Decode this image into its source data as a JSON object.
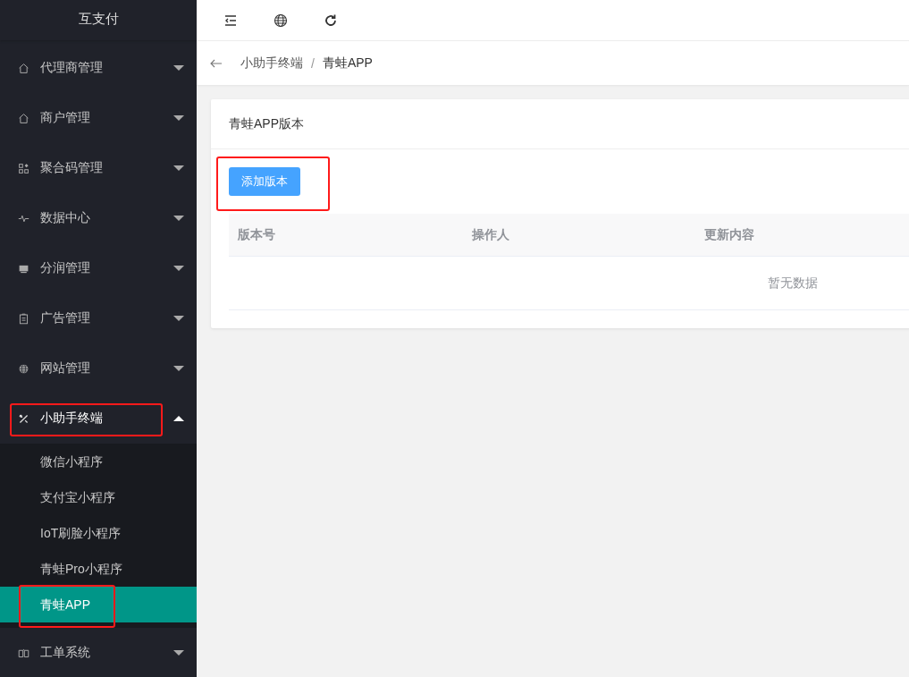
{
  "sidebar": {
    "logo": "互支付",
    "items": [
      {
        "label": "代理商管理",
        "expanded": false,
        "highlighted": false
      },
      {
        "label": "商户管理",
        "expanded": false,
        "highlighted": false
      },
      {
        "label": "聚合码管理",
        "expanded": false,
        "highlighted": false
      },
      {
        "label": "数据中心",
        "expanded": false,
        "highlighted": false
      },
      {
        "label": "分润管理",
        "expanded": false,
        "highlighted": false
      },
      {
        "label": "广告管理",
        "expanded": false,
        "highlighted": false
      },
      {
        "label": "网站管理",
        "expanded": false,
        "highlighted": false
      },
      {
        "label": "小助手终端",
        "expanded": true,
        "highlighted": true,
        "children": [
          {
            "label": "微信小程序",
            "selected": false,
            "highlighted": false
          },
          {
            "label": "支付宝小程序",
            "selected": false,
            "highlighted": false
          },
          {
            "label": "IoT刷脸小程序",
            "selected": false,
            "highlighted": false
          },
          {
            "label": "青蛙Pro小程序",
            "selected": false,
            "highlighted": false
          },
          {
            "label": "青蛙APP",
            "selected": true,
            "highlighted": true
          }
        ]
      },
      {
        "label": "工单系统",
        "expanded": false,
        "highlighted": false
      }
    ]
  },
  "breadcrumb": {
    "items": [
      "小助手终端",
      "青蛙APP"
    ],
    "separator": "/"
  },
  "card": {
    "title": "青蛙APP版本",
    "add_button": {
      "label": "添加版本",
      "highlighted": true
    },
    "table": {
      "columns": [
        "版本号",
        "操作人",
        "更新内容"
      ],
      "empty_text": "暂无数据"
    }
  }
}
